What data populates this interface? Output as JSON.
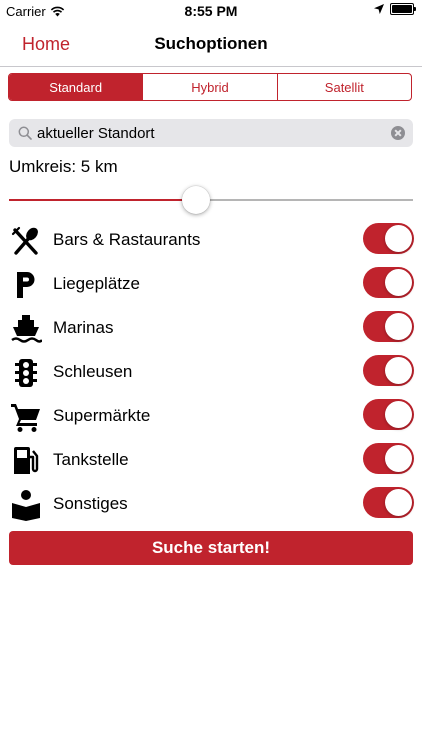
{
  "status_bar": {
    "carrier": "Carrier",
    "time": "8:55 PM"
  },
  "nav": {
    "back_label": "Home",
    "title": "Suchoptionen"
  },
  "map_type": {
    "segments": [
      {
        "label": "Standard",
        "selected": true
      },
      {
        "label": "Hybrid",
        "selected": false
      },
      {
        "label": "Satellit",
        "selected": false
      }
    ]
  },
  "search": {
    "value": "aktueller Standort"
  },
  "radius": {
    "label": "Umkreis: 5 km",
    "slider_fraction": 0.46
  },
  "categories": [
    {
      "label": "Bars & Rastaurants",
      "icon": "fork-spoon-icon",
      "enabled": true
    },
    {
      "label": "Liegeplätze",
      "icon": "parking-icon",
      "enabled": true
    },
    {
      "label": "Marinas",
      "icon": "boat-icon",
      "enabled": true
    },
    {
      "label": "Schleusen",
      "icon": "traffic-light-icon",
      "enabled": true
    },
    {
      "label": "Supermärkte",
      "icon": "shopping-cart-icon",
      "enabled": true
    },
    {
      "label": "Tankstelle",
      "icon": "fuel-pump-icon",
      "enabled": true
    },
    {
      "label": "Sonstiges",
      "icon": "reader-icon",
      "enabled": true
    }
  ],
  "action": {
    "label": "Suche starten!"
  },
  "colors": {
    "accent": "#c0232d",
    "track_off": "#b5b5b5",
    "search_bg": "#e6e6e9"
  }
}
